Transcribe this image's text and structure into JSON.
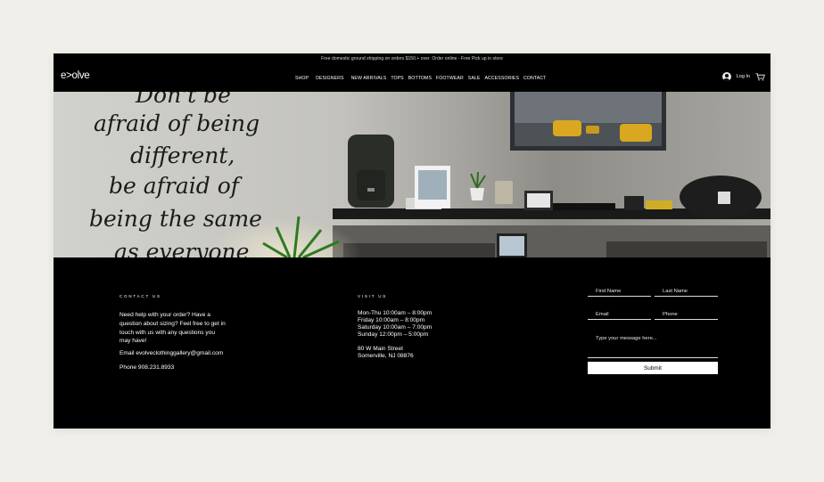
{
  "announcement": "Free domestic ground shipping on orders $150.+ over. Order online - Free Pick up in store",
  "brand": {
    "logo": "e>olve"
  },
  "nav": {
    "items": [
      {
        "label": "SHOP"
      },
      {
        "label": "DESIGNERS"
      },
      {
        "label": "NEW ARRIVALS"
      },
      {
        "label": "TOPS"
      },
      {
        "label": "BOTTOMS"
      },
      {
        "label": "FOOTWEAR"
      },
      {
        "label": "SALE"
      },
      {
        "label": "ACCESSORIES"
      },
      {
        "label": "CONTACT"
      }
    ]
  },
  "user": {
    "login_label": "Log In",
    "avatar_icon": "user-avatar-icon",
    "cart_icon": "cart-icon"
  },
  "hero": {
    "wall_text": [
      "Don't be",
      "afraid of being",
      "different,",
      "be afraid of",
      "being the same",
      "as everyone"
    ]
  },
  "footer": {
    "contact": {
      "title": "CONTACT US",
      "body": "Need help with your order? Have a question about sizing? Feel free to get in touch with us with any questions you may have!",
      "email": "Email evolveclothinggallery@gmail.com",
      "phone": "Phone 908.231.8933"
    },
    "visit": {
      "title": "VISIT US",
      "hours": [
        "Mon-Thu 10:00am – 8:00pm",
        "Friday 10:00am – 8:00pm",
        "Saturday 10:00am – 7:00pm",
        "Sunday 12:00pm – 5:00pm"
      ],
      "address": [
        "80 W Main Street",
        "Somerville, NJ 08876"
      ]
    },
    "form": {
      "first_name_placeholder": "First Name",
      "last_name_placeholder": "Last Name",
      "email_placeholder": "Email",
      "phone_placeholder": "Phone",
      "message_placeholder": "Type your message here...",
      "submit_label": "Submit"
    }
  },
  "colors": {
    "background": "#f1efea",
    "site_bg": "#000000",
    "text": "#ffffff",
    "submit_bg": "#ffffff"
  }
}
